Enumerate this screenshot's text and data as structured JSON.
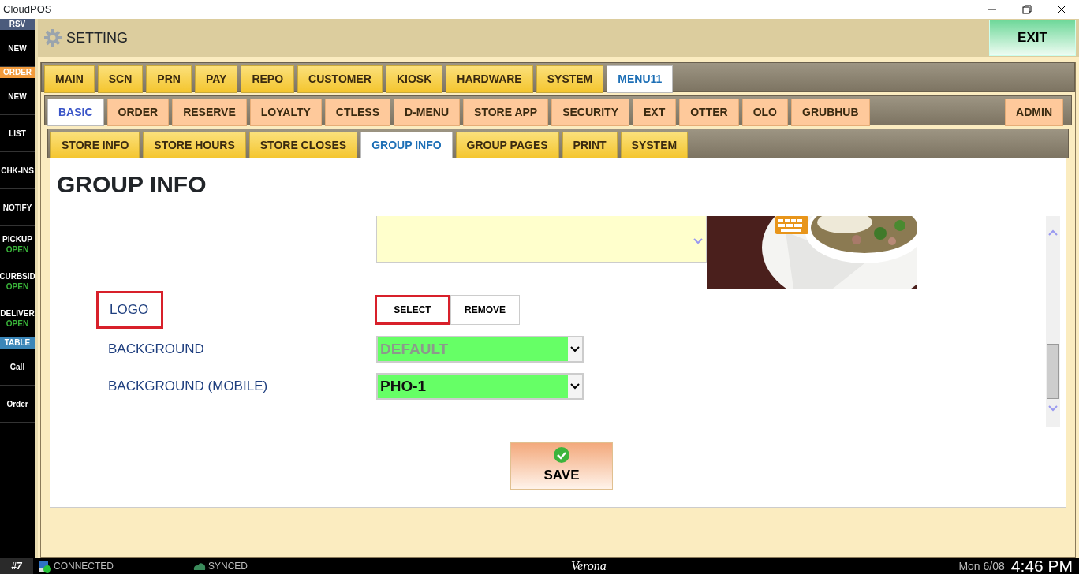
{
  "window": {
    "title": "CloudPOS"
  },
  "sidebar": {
    "items": [
      {
        "kind": "header",
        "label": "RSV",
        "color": "#4b5b7c"
      },
      {
        "kind": "button",
        "label": "NEW"
      },
      {
        "kind": "header",
        "label": "ORDER",
        "color": "#f29b3c"
      },
      {
        "kind": "button",
        "label": "NEW"
      },
      {
        "kind": "button",
        "label": "LIST"
      },
      {
        "kind": "button",
        "label": "CHK-INS"
      },
      {
        "kind": "button",
        "label": "NOTIFY"
      },
      {
        "kind": "button",
        "label": "PICKUP",
        "status": "OPEN"
      },
      {
        "kind": "button",
        "label": "CURBSID",
        "status": "OPEN"
      },
      {
        "kind": "button",
        "label": "DELIVER",
        "status": "OPEN"
      },
      {
        "kind": "header",
        "label": "TABLE",
        "color": "#3b86b8"
      },
      {
        "kind": "button",
        "label": "Call"
      },
      {
        "kind": "button",
        "label": "Order"
      }
    ]
  },
  "header": {
    "title": "SETTING",
    "exit": "EXIT"
  },
  "tabs": [
    {
      "label": "MAIN",
      "selected": false
    },
    {
      "label": "SCN",
      "selected": false
    },
    {
      "label": "PRN",
      "selected": false
    },
    {
      "label": "PAY",
      "selected": false
    },
    {
      "label": "REPO",
      "selected": false
    },
    {
      "label": "CUSTOMER",
      "selected": false
    },
    {
      "label": "KIOSK",
      "selected": false
    },
    {
      "label": "HARDWARE",
      "selected": false
    },
    {
      "label": "SYSTEM",
      "selected": false
    },
    {
      "label": "MENU11",
      "selected": true
    }
  ],
  "subtabs": [
    {
      "label": "BASIC",
      "selected": true
    },
    {
      "label": "ORDER",
      "selected": false
    },
    {
      "label": "RESERVE",
      "selected": false
    },
    {
      "label": "LOYALTY",
      "selected": false
    },
    {
      "label": "CTLESS",
      "selected": false
    },
    {
      "label": "D-MENU",
      "selected": false
    },
    {
      "label": "STORE APP",
      "selected": false
    },
    {
      "label": "SECURITY",
      "selected": false
    },
    {
      "label": "EXT",
      "selected": false
    },
    {
      "label": "OTTER",
      "selected": false
    },
    {
      "label": "OLO",
      "selected": false
    },
    {
      "label": "GRUBHUB",
      "selected": false
    }
  ],
  "end_subtabs": [
    {
      "label": "ADMIN",
      "selected": false
    }
  ],
  "section_tabs": [
    {
      "label": "STORE INFO",
      "selected": false
    },
    {
      "label": "STORE HOURS",
      "selected": false
    },
    {
      "label": "STORE CLOSES",
      "selected": false
    },
    {
      "label": "GROUP INFO",
      "selected": true
    },
    {
      "label": "GROUP PAGES",
      "selected": false
    },
    {
      "label": "PRINT",
      "selected": false
    },
    {
      "label": "SYSTEM",
      "selected": false
    }
  ],
  "page": {
    "heading": "GROUP INFO",
    "logo": {
      "label": "LOGO",
      "highlighted": true,
      "buttons": [
        {
          "label": "SELECT",
          "highlighted": true
        },
        {
          "label": "REMOVE",
          "highlighted": false
        }
      ]
    },
    "selects": [
      {
        "label": "BACKGROUND",
        "value": "DEFAULT",
        "disabled": true
      },
      {
        "label": "BACKGROUND (MOBILE)",
        "value": "PHO-1",
        "disabled": false
      }
    ],
    "save": "SAVE"
  },
  "status_bar": {
    "station": "#7",
    "connection": "CONNECTED",
    "sync": "SYNCED",
    "store": "Verona",
    "date": "Mon 6/08",
    "time": "4:46 PM"
  }
}
